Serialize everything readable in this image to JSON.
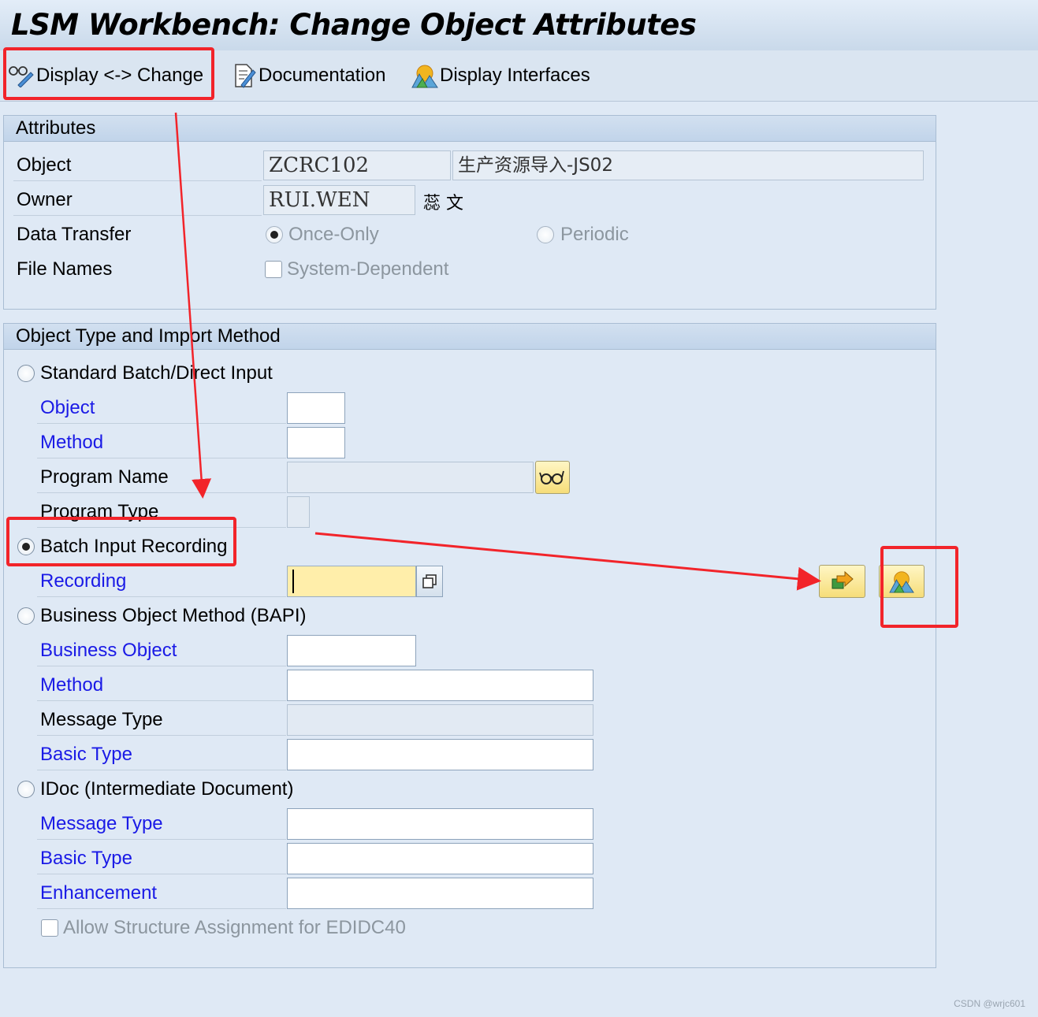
{
  "window": {
    "title": "LSM Workbench: Change Object Attributes"
  },
  "toolbar": {
    "display_change": {
      "label": "Display <-> Change",
      "icon": "glasses-pencil-icon"
    },
    "documentation": {
      "label": "Documentation",
      "icon": "document-pencil-icon"
    },
    "display_interfaces": {
      "label": "Display Interfaces",
      "icon": "mountain-sun-icon"
    }
  },
  "attributes": {
    "title": "Attributes",
    "object_label": "Object",
    "object_value": "ZCRC102",
    "object_desc": "生产资源导入-JS02",
    "owner_label": "Owner",
    "owner_value": "RUI.WEN",
    "owner_name": "蕊 文",
    "data_transfer_label": "Data Transfer",
    "once_only": "Once-Only",
    "once_only_selected": true,
    "periodic": "Periodic",
    "file_names_label": "File Names",
    "system_dependent": "System-Dependent"
  },
  "import_method": {
    "title": "Object Type and Import Method",
    "standard": {
      "label": "Standard Batch/Direct Input",
      "object_label": "Object",
      "object_value": "",
      "method_label": "Method",
      "method_value": "",
      "program_name_label": "Program Name",
      "program_name_value": "",
      "program_type_label": "Program Type",
      "program_type_value": ""
    },
    "batch_input": {
      "label": "Batch Input Recording",
      "selected": true,
      "recording_label": "Recording",
      "recording_value": ""
    },
    "bapi": {
      "label": "Business Object Method  (BAPI)",
      "business_object_label": "Business Object",
      "method_label": "Method",
      "message_type_label": "Message Type",
      "basic_type_label": "Basic Type"
    },
    "idoc": {
      "label": "IDoc (Intermediate Document)",
      "message_type_label": "Message Type",
      "basic_type_label": "Basic Type",
      "enhancement_label": "Enhancement",
      "allow_structure": "Allow Structure Assignment for EDIDC40"
    }
  },
  "annotations": {
    "highlight_color": "#f2242a"
  },
  "watermark": "CSDN @wrjc601"
}
